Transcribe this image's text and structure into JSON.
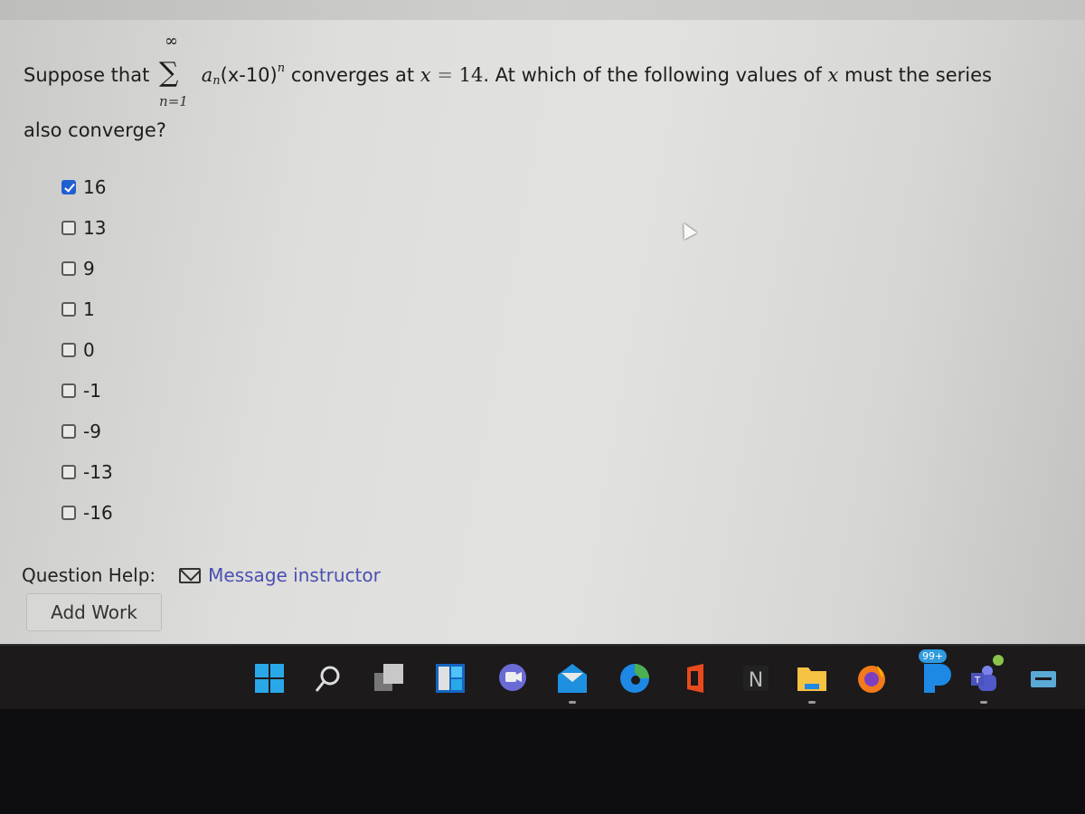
{
  "question": {
    "prefix": "Suppose that",
    "sum_upper": "∞",
    "sum_lower": "n=1",
    "term_coef": "a",
    "term_coef_sub": "n",
    "term_body": "(x-10)",
    "term_exp": "n",
    "middle": "converges at",
    "var": "x",
    "eq": " = ",
    "point": "14",
    "suffix_a": ". At which of the following values of",
    "suffix_var": "x",
    "suffix_b": "must the series",
    "line2": "also converge?"
  },
  "choices": [
    {
      "label": "16",
      "checked": true
    },
    {
      "label": "13",
      "checked": false
    },
    {
      "label": "9",
      "checked": false
    },
    {
      "label": "1",
      "checked": false
    },
    {
      "label": "0",
      "checked": false
    },
    {
      "label": "-1",
      "checked": false
    },
    {
      "label": "-9",
      "checked": false
    },
    {
      "label": "-13",
      "checked": false
    },
    {
      "label": "-16",
      "checked": false
    }
  ],
  "help": {
    "label": "Question Help:",
    "message_link": "Message instructor",
    "add_work": "Add Work"
  },
  "taskbar": {
    "items": [
      {
        "name": "start",
        "icon": "windows-start-icon",
        "color": "#29a8e8"
      },
      {
        "name": "search",
        "icon": "search-icon",
        "color": "#d8d8d8"
      },
      {
        "name": "task-view",
        "icon": "task-view-icon",
        "color": "#bdbdbd"
      },
      {
        "name": "widgets",
        "icon": "widgets-icon",
        "color": "#1e88e5"
      },
      {
        "name": "chat",
        "icon": "chat-icon",
        "color": "#6b6bd6"
      },
      {
        "name": "mail",
        "icon": "mail-icon",
        "color": "#1e90e0"
      },
      {
        "name": "edge",
        "icon": "edge-icon",
        "color": "#1aa6b7"
      },
      {
        "name": "office",
        "icon": "office-icon",
        "color": "#e84a1d"
      },
      {
        "name": "notion",
        "icon": "notion-icon",
        "color": "#3a3a3a"
      },
      {
        "name": "file-explorer",
        "icon": "folder-icon",
        "color": "#f5c242"
      },
      {
        "name": "firefox",
        "icon": "firefox-icon",
        "color": "#f27a1a"
      },
      {
        "name": "pandora",
        "icon": "pandora-icon",
        "color": "#1e88e5",
        "badge": "99+"
      },
      {
        "name": "teams",
        "icon": "teams-icon",
        "color": "#5059c9"
      },
      {
        "name": "keyboard",
        "icon": "keyboard-icon",
        "color": "#5aa9d6"
      }
    ]
  }
}
